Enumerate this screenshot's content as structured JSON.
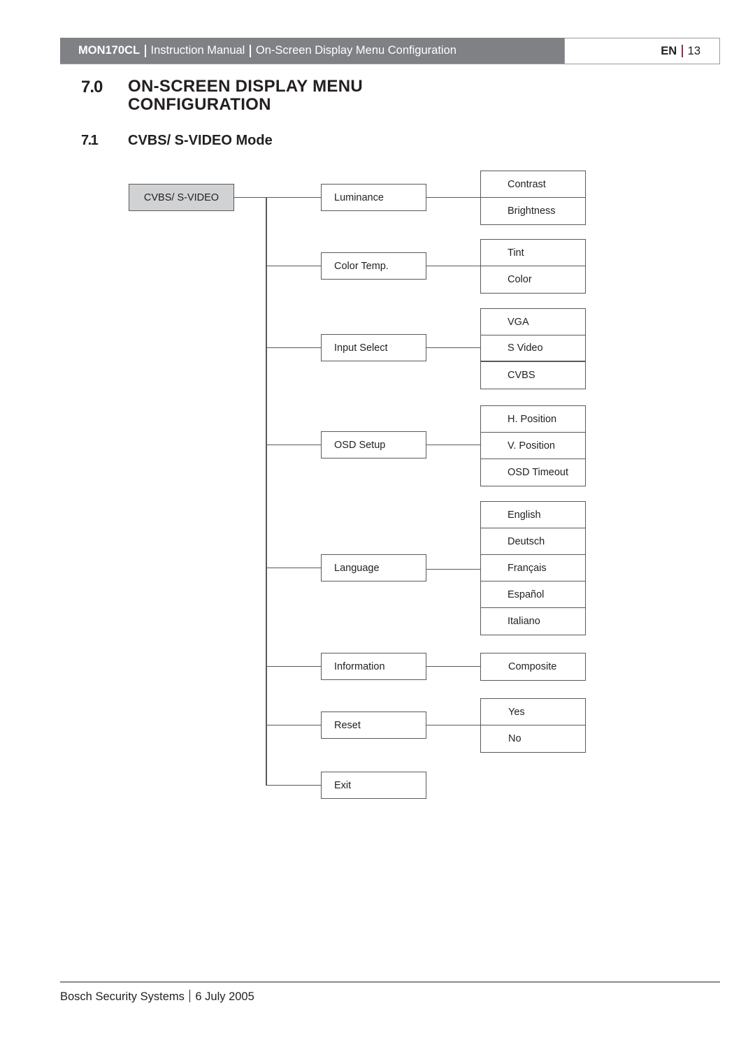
{
  "header": {
    "product": "MON170CL",
    "doc_type": "Instruction Manual",
    "section": "On-Screen Display Menu Configuration",
    "language": "EN",
    "page_number": "13"
  },
  "heading1": {
    "number": "7.0",
    "title": "ON-SCREEN DISPLAY MENU CONFIGURATION"
  },
  "heading2": {
    "number": "7.1",
    "title": "CVBS/ S-VIDEO Mode"
  },
  "diagram": {
    "root": "CVBS/ S-VIDEO",
    "menus": [
      {
        "label": "Luminance",
        "options": [
          "Contrast",
          "Brightness"
        ]
      },
      {
        "label": "Color Temp.",
        "options": [
          "Tint",
          "Color"
        ]
      },
      {
        "label": "Input Select",
        "options": [
          "VGA",
          "S Video",
          "CVBS"
        ]
      },
      {
        "label": "OSD Setup",
        "options": [
          "H. Position",
          "V. Position",
          "OSD Timeout"
        ]
      },
      {
        "label": "Language",
        "options": [
          "English",
          "Deutsch",
          "Français",
          "Español",
          "Italiano"
        ]
      },
      {
        "label": "Information",
        "options": [
          "Composite"
        ]
      },
      {
        "label": "Reset",
        "options": [
          "Yes",
          "No"
        ]
      },
      {
        "label": "Exit",
        "options": []
      }
    ]
  },
  "footer": {
    "company": "Bosch Security Systems",
    "date": "6 July 2005"
  },
  "colors": {
    "header_bar": "#808184",
    "root_box_fill": "#d1d2d4",
    "line": "#58595b",
    "text": "#231f20"
  }
}
